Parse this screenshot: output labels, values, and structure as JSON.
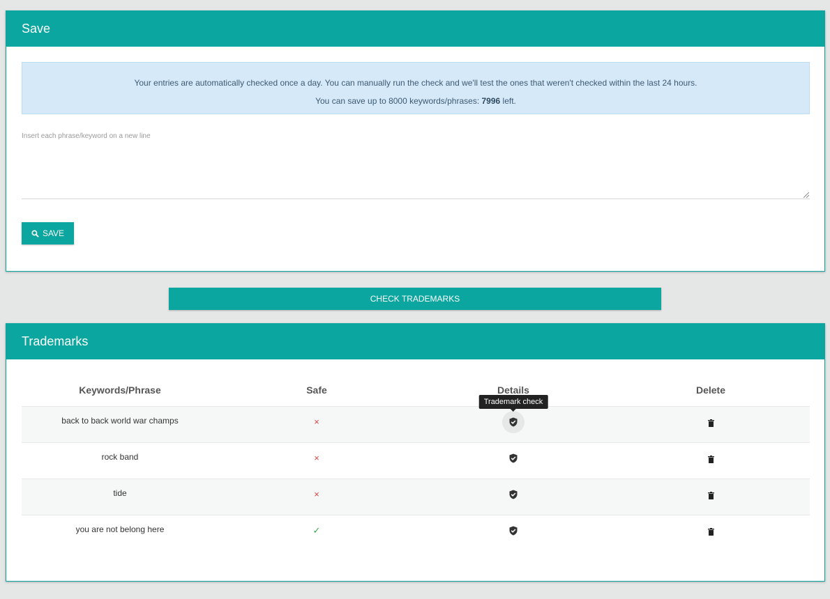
{
  "save_card": {
    "title": "Save",
    "info_line1": "Your entries are automatically checked once a day. You can manually run the check and we'll test the ones that weren't checked within the last 24 hours.",
    "info_line2_prefix": "You can save up to 8000 keywords/phrases: ",
    "info_line2_count": "7996",
    "info_line2_suffix": " left.",
    "textarea_placeholder": "Insert each phrase/keyword on a new line",
    "textarea_value": "",
    "save_button_label": "SAVE",
    "save_button_icon": "search-icon"
  },
  "check_button_label": "CHECK TRADEMARKS",
  "trademarks_card": {
    "title": "Trademarks",
    "columns": [
      "Keywords/Phrase",
      "Safe",
      "Details",
      "Delete"
    ],
    "tooltip": "Trademark check",
    "rows": [
      {
        "keyword": "back to back world war champs",
        "safe": false,
        "safe_icon": "×"
      },
      {
        "keyword": "rock band",
        "safe": false,
        "safe_icon": "×"
      },
      {
        "keyword": "tide",
        "safe": false,
        "safe_icon": "×"
      },
      {
        "keyword": "you are not belong here",
        "safe": true,
        "safe_icon": "✓"
      }
    ]
  },
  "colors": {
    "accent": "#0ba69f",
    "unsafe": "#e0454a",
    "safe": "#3ea64e",
    "info_bg": "#d6e9f8"
  }
}
